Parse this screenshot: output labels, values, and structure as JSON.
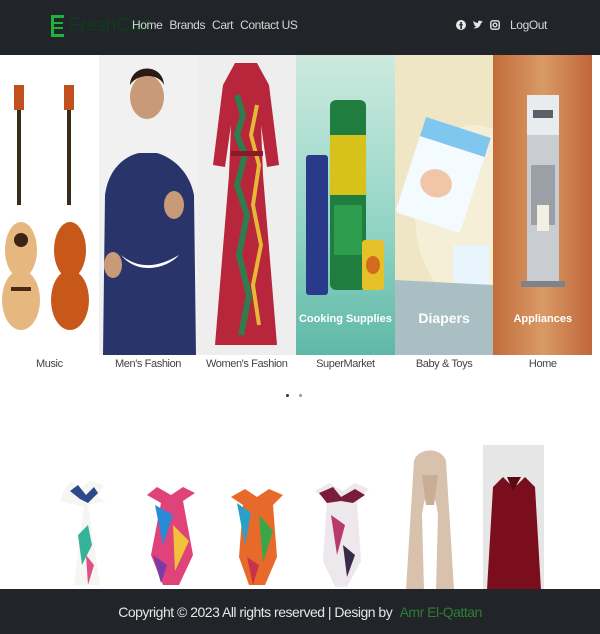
{
  "navbar": {
    "brand": "FreshCart",
    "links": [
      "Home",
      "Brands",
      "Cart",
      "Contact US"
    ],
    "social_icons": [
      "facebook-icon",
      "twitter-icon",
      "instagram-icon"
    ],
    "logout": "LogOut"
  },
  "categories": [
    {
      "label": "Music",
      "banner": ""
    },
    {
      "label": "Men's Fashion",
      "banner": ""
    },
    {
      "label": "Women's Fashion",
      "banner": ""
    },
    {
      "label": "SuperMarket",
      "banner": "Cooking Supplies"
    },
    {
      "label": "Baby & Toys",
      "banner": "Diapers"
    },
    {
      "label": "Home",
      "banner": "Appliances"
    }
  ],
  "carousel": {
    "dots": 2,
    "active": 0
  },
  "footer": {
    "text": "Copyright © 2023 All rights reserved | Design by",
    "author": "Amr El-Qattan"
  },
  "colors": {
    "navbar_bg": "#212529",
    "brand_green": "#2e7d32"
  }
}
